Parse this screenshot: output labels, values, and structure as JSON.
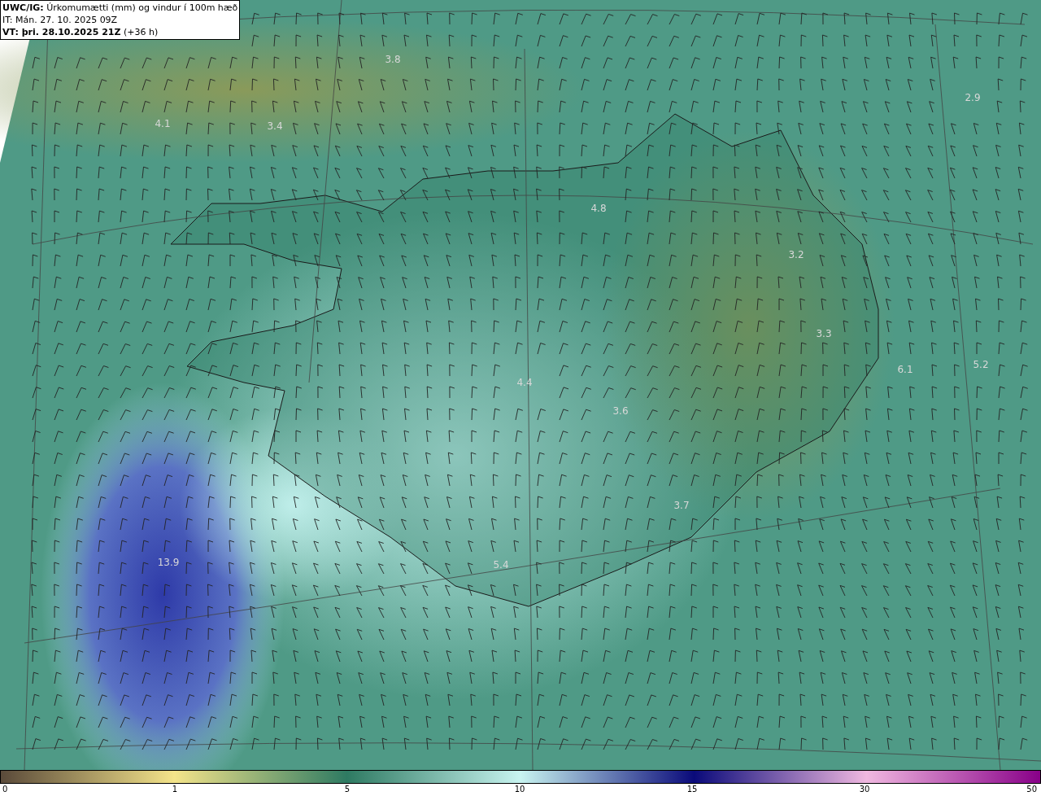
{
  "header": {
    "lines": [
      "**UWC/IG:** Úrkomumætti (mm) og vindur í 100m hæð",
      "IT: Mán. 27. 10. 2025 09Z",
      "**VT: þri. 28.10.2025 21Z** (+36 h)"
    ]
  },
  "map": {
    "value_labels": [
      "3.8",
      "4.1",
      "3.4",
      "2.9",
      "4.8",
      "3.2",
      "3.3",
      "6.1",
      "5.2",
      "4.4",
      "3.6",
      "3.7",
      "13.9",
      "5.4"
    ]
  },
  "colorbar": {
    "ticks": [
      "0",
      "1",
      "5",
      "10",
      "15",
      "30",
      "50"
    ]
  }
}
